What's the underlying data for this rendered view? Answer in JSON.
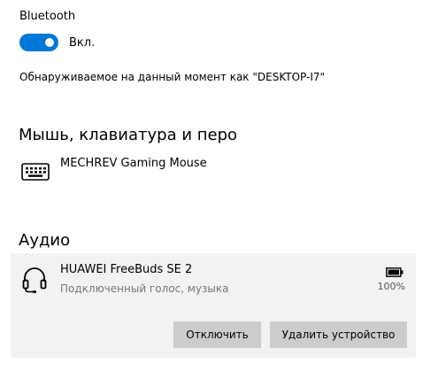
{
  "bluetooth": {
    "label": "Bluetooth",
    "toggle_state": "Вкл.",
    "toggle_on": true,
    "discoverable_text": "Обнаруживаемое на данный момент как \"DESKTOP-I7\""
  },
  "mouse_section": {
    "title": "Мышь, клавиатура и перо",
    "devices": [
      {
        "name": "MECHREV Gaming Mouse",
        "icon": "keyboard-icon"
      }
    ]
  },
  "audio_section": {
    "title": "Аудио",
    "devices": [
      {
        "name": "HUAWEI FreeBuds SE 2",
        "status": "Подключенный голос, музыка",
        "battery": "100%",
        "icon": "headset-icon",
        "buttons": {
          "disconnect": "Отключить",
          "remove": "Удалить устройство"
        }
      }
    ]
  },
  "colors": {
    "accent": "#0078d7",
    "panel_bg": "#f2f2f2",
    "button_bg": "#cccccc",
    "secondary_text": "#767676"
  }
}
